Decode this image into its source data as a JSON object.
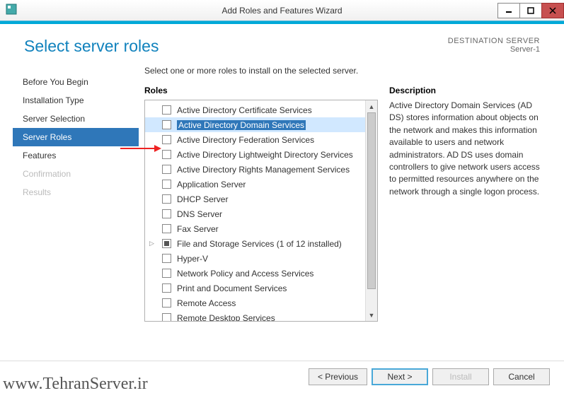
{
  "window": {
    "title": "Add Roles and Features Wizard"
  },
  "header": {
    "heading": "Select server roles",
    "destination_label": "DESTINATION SERVER",
    "destination_server": "Server-1"
  },
  "nav": {
    "items": [
      {
        "label": "Before You Begin",
        "state": "normal"
      },
      {
        "label": "Installation Type",
        "state": "normal"
      },
      {
        "label": "Server Selection",
        "state": "normal"
      },
      {
        "label": "Server Roles",
        "state": "active"
      },
      {
        "label": "Features",
        "state": "normal"
      },
      {
        "label": "Confirmation",
        "state": "disabled"
      },
      {
        "label": "Results",
        "state": "disabled"
      }
    ]
  },
  "main": {
    "instruction": "Select one or more roles to install on the selected server.",
    "roles_label": "Roles",
    "description_label": "Description",
    "roles": [
      {
        "label": "Active Directory Certificate Services",
        "checked": false,
        "selected": false
      },
      {
        "label": "Active Directory Domain Services",
        "checked": false,
        "selected": true
      },
      {
        "label": "Active Directory Federation Services",
        "checked": false,
        "selected": false
      },
      {
        "label": "Active Directory Lightweight Directory Services",
        "checked": false,
        "selected": false
      },
      {
        "label": "Active Directory Rights Management Services",
        "checked": false,
        "selected": false
      },
      {
        "label": "Application Server",
        "checked": false,
        "selected": false
      },
      {
        "label": "DHCP Server",
        "checked": false,
        "selected": false
      },
      {
        "label": "DNS Server",
        "checked": false,
        "selected": false
      },
      {
        "label": "Fax Server",
        "checked": false,
        "selected": false
      },
      {
        "label": "File and Storage Services (1 of 12 installed)",
        "checked": "partial",
        "selected": false,
        "expandable": true
      },
      {
        "label": "Hyper-V",
        "checked": false,
        "selected": false
      },
      {
        "label": "Network Policy and Access Services",
        "checked": false,
        "selected": false
      },
      {
        "label": "Print and Document Services",
        "checked": false,
        "selected": false
      },
      {
        "label": "Remote Access",
        "checked": false,
        "selected": false
      },
      {
        "label": "Remote Desktop Services",
        "checked": false,
        "selected": false
      }
    ],
    "description_text": "Active Directory Domain Services (AD DS) stores information about objects on the network and makes this information available to users and network administrators. AD DS uses domain controllers to give network users access to permitted resources anywhere on the network through a single logon process."
  },
  "buttons": {
    "previous": "< Previous",
    "next": "Next >",
    "install": "Install",
    "cancel": "Cancel"
  },
  "watermark": "www.TehranServer.ir"
}
